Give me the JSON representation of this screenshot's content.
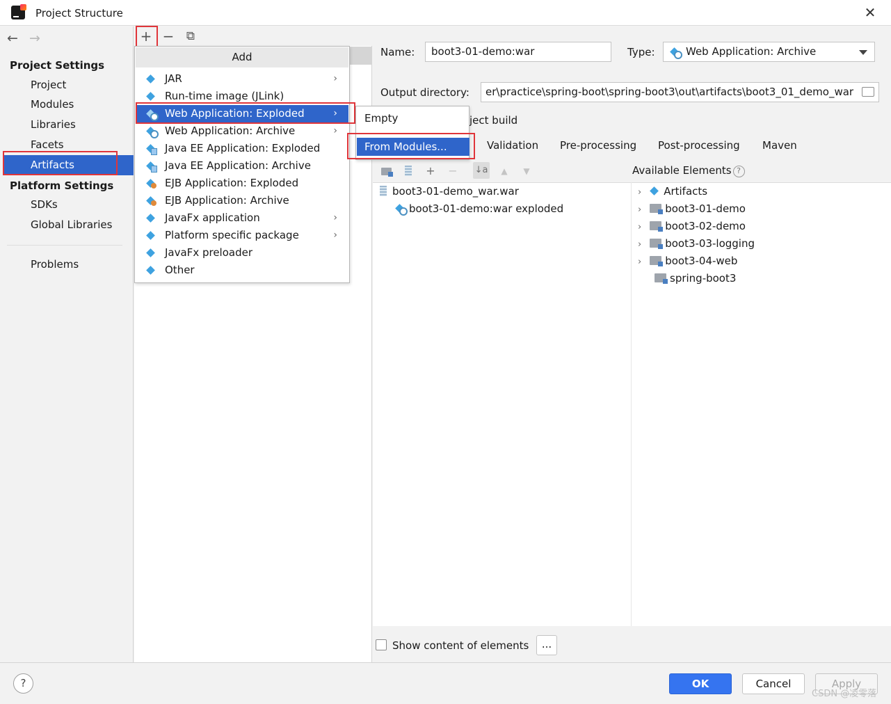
{
  "window": {
    "title": "Project Structure",
    "close_glyph": "✕"
  },
  "nav": {
    "back_glyph": "←",
    "forward_glyph": "→",
    "project_settings_heading": "Project Settings",
    "project_settings_items": [
      "Project",
      "Modules",
      "Libraries",
      "Facets",
      "Artifacts"
    ],
    "selected_item": "Artifacts",
    "platform_settings_heading": "Platform Settings",
    "platform_settings_items": [
      "SDKs",
      "Global Libraries"
    ],
    "problems_label": "Problems"
  },
  "artifact_toolbar": {
    "add_glyph": "+",
    "remove_glyph": "−",
    "copy_glyph": "⧉"
  },
  "add_menu": {
    "header": "Add",
    "chevron_glyph": "›",
    "items": [
      {
        "label": "JAR",
        "icon": "artifact-icon",
        "submenu": true
      },
      {
        "label": "Run-time image (JLink)",
        "icon": "artifact-icon",
        "submenu": false
      },
      {
        "label": "Web Application: Exploded",
        "icon": "web-artifact-icon",
        "submenu": true,
        "selected": true
      },
      {
        "label": "Web Application: Archive",
        "icon": "web-artifact-icon",
        "submenu": true
      },
      {
        "label": "Java EE Application: Exploded",
        "icon": "javaee-artifact-icon",
        "submenu": false
      },
      {
        "label": "Java EE Application: Archive",
        "icon": "javaee-artifact-icon",
        "submenu": false
      },
      {
        "label": "EJB Application: Exploded",
        "icon": "ejb-artifact-icon",
        "submenu": false
      },
      {
        "label": "EJB Application: Archive",
        "icon": "ejb-artifact-icon",
        "submenu": false
      },
      {
        "label": "JavaFx application",
        "icon": "artifact-icon",
        "submenu": true
      },
      {
        "label": "Platform specific package",
        "icon": "artifact-icon",
        "submenu": true
      },
      {
        "label": "JavaFx preloader",
        "icon": "artifact-icon",
        "submenu": false
      },
      {
        "label": "Other",
        "icon": "artifact-icon",
        "submenu": false
      }
    ]
  },
  "submenu": {
    "items": [
      "Empty",
      "From Modules..."
    ],
    "selected": "From Modules..."
  },
  "artifact_form": {
    "name_label": "Name:",
    "name_value": "boot3-01-demo:war",
    "type_label": "Type:",
    "type_value": "Web Application: Archive",
    "output_label": "Output directory:",
    "output_value": "er\\practice\\spring-boot\\spring-boot3\\out\\artifacts\\boot3_01_demo_war",
    "include_build_partial": "ject build",
    "tabs": [
      "Validation",
      "Pre-processing",
      "Post-processing",
      "Maven"
    ]
  },
  "output_layout": {
    "toolbar_glyphs": {
      "add": "+",
      "remove": "−",
      "sort": "↓a",
      "up": "▲",
      "down": "▼"
    },
    "tree": [
      {
        "label": "boot3-01-demo_war.war",
        "level": 0,
        "icon": "war-icon"
      },
      {
        "label": "boot3-01-demo:war exploded",
        "level": 1,
        "icon": "web-artifact-icon"
      }
    ],
    "available_heading": "Available Elements",
    "help_glyph": "?",
    "available": [
      {
        "label": "Artifacts",
        "icon": "artifact-icon",
        "expandable": true
      },
      {
        "label": "boot3-01-demo",
        "icon": "module-folder-icon",
        "expandable": true
      },
      {
        "label": "boot3-02-demo",
        "icon": "module-folder-icon",
        "expandable": true
      },
      {
        "label": "boot3-03-logging",
        "icon": "module-folder-icon",
        "expandable": true
      },
      {
        "label": "boot3-04-web",
        "icon": "module-folder-icon",
        "expandable": true
      },
      {
        "label": "spring-boot3",
        "icon": "module-folder-icon",
        "expandable": false
      }
    ],
    "tree_arrow_glyph": "›",
    "show_content_label": "Show content of elements",
    "show_content_checked": false,
    "ellipsis_label": "..."
  },
  "footer": {
    "help_label": "?",
    "ok_label": "OK",
    "cancel_label": "Cancel",
    "apply_label": "Apply",
    "watermark": "CSDN @凌零落"
  },
  "colors": {
    "selection": "#2f65ca",
    "highlight_box": "#e0353a",
    "primary_button": "#3574f0"
  }
}
